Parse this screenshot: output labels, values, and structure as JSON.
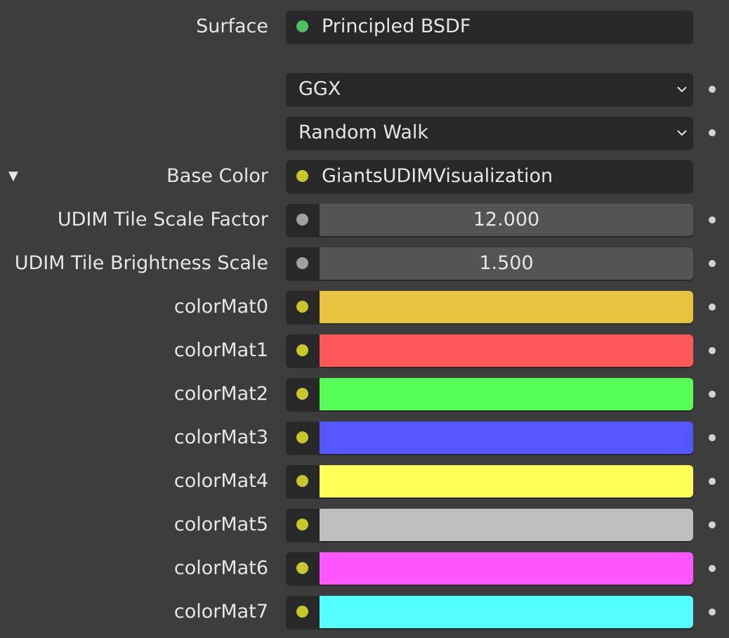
{
  "surface": {
    "label": "Surface",
    "value": "Principled BSDF",
    "socket_color": "#4fbf61"
  },
  "distribution": {
    "value": "GGX"
  },
  "subsurface_method": {
    "value": "Random Walk"
  },
  "base_color": {
    "label": "Base Color",
    "value": "GiantsUDIMVisualization",
    "socket_color": "#c7c729",
    "expander": "▼"
  },
  "tile_scale": {
    "label": "UDIM Tile Scale Factor",
    "value": "12.000",
    "socket_color": "#a1a1a1"
  },
  "tile_brightness": {
    "label": "UDIM Tile Brightness Scale",
    "value": "1.500",
    "socket_color": "#a1a1a1"
  },
  "color_socket": "#c7c729",
  "color_mats": [
    {
      "label": "colorMat0",
      "color": "#e5c33e"
    },
    {
      "label": "colorMat1",
      "color": "#ff5858"
    },
    {
      "label": "colorMat2",
      "color": "#56ff56"
    },
    {
      "label": "colorMat3",
      "color": "#5656ff"
    },
    {
      "label": "colorMat4",
      "color": "#ffff56"
    },
    {
      "label": "colorMat5",
      "color": "#bebebe"
    },
    {
      "label": "colorMat6",
      "color": "#ff56ff"
    },
    {
      "label": "colorMat7",
      "color": "#56ffff"
    }
  ]
}
